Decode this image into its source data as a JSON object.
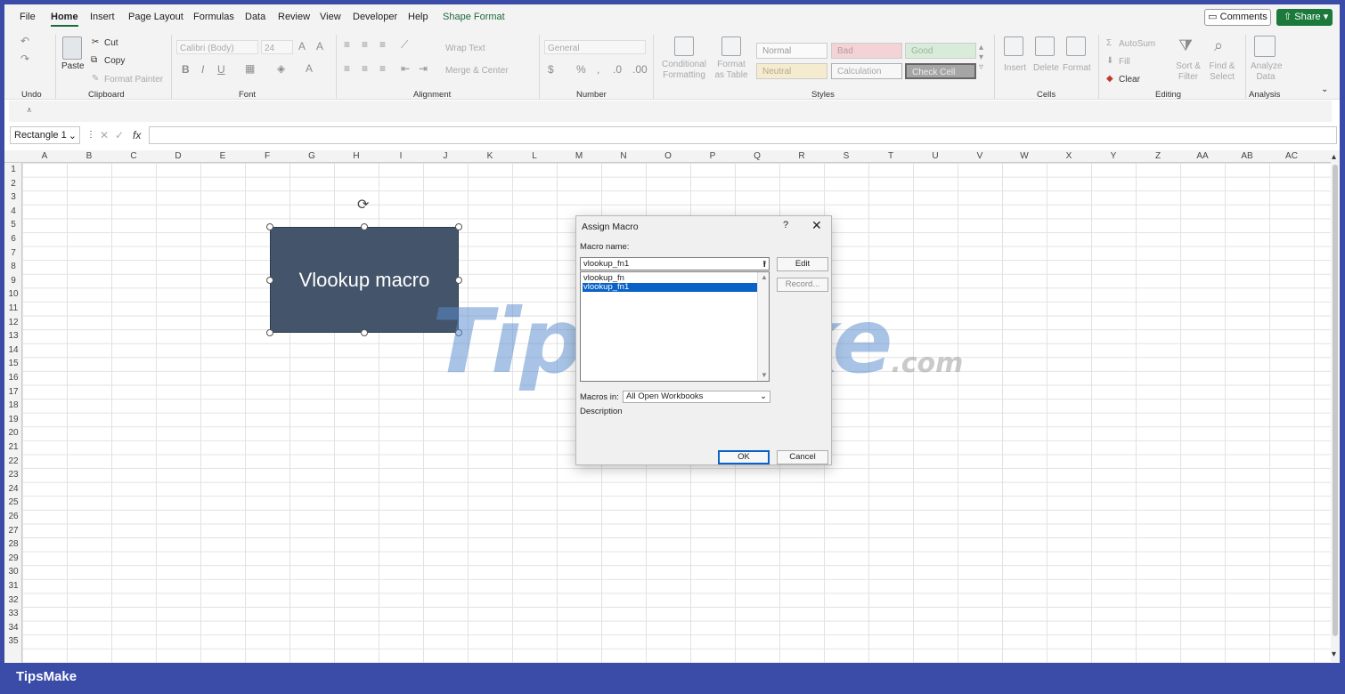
{
  "menu": {
    "items": [
      "File",
      "Home",
      "Insert",
      "Page Layout",
      "Formulas",
      "Data",
      "Review",
      "View",
      "Developer",
      "Help",
      "Shape Format"
    ],
    "active": "Home",
    "comments": "Comments",
    "share": "Share"
  },
  "ribbon": {
    "undo_group": "Undo",
    "clipboard": {
      "paste": "Paste",
      "cut": "Cut",
      "copy": "Copy",
      "format_painter": "Format Painter",
      "label": "Clipboard"
    },
    "font": {
      "name": "Calibri (Body)",
      "size": "24",
      "bold": "B",
      "italic": "I",
      "underline": "U",
      "label": "Font"
    },
    "alignment": {
      "wrap": "Wrap Text",
      "merge": "Merge & Center",
      "label": "Alignment"
    },
    "number": {
      "format": "General",
      "label": "Number"
    },
    "styles": {
      "cond_format": "Conditional Formatting",
      "format_table": "Format as Table",
      "cells": [
        "Normal",
        "Bad",
        "Good",
        "Neutral",
        "Calculation",
        "Check Cell"
      ],
      "label": "Styles"
    },
    "cells_group": {
      "insert": "Insert",
      "delete": "Delete",
      "format": "Format",
      "label": "Cells"
    },
    "editing": {
      "autosum": "AutoSum",
      "fill": "Fill",
      "clear": "Clear",
      "sort": "Sort & Filter",
      "find": "Find & Select",
      "label": "Editing"
    },
    "analysis": {
      "analyze": "Analyze Data",
      "label": "Analysis"
    }
  },
  "namebox": "Rectangle 1",
  "fx": "fx",
  "columns": [
    "A",
    "B",
    "C",
    "D",
    "E",
    "F",
    "G",
    "H",
    "I",
    "J",
    "K",
    "L",
    "M",
    "N",
    "O",
    "P",
    "Q",
    "R",
    "S",
    "T",
    "U",
    "V",
    "W",
    "X",
    "Y",
    "Z",
    "AA",
    "AB",
    "AC"
  ],
  "rows": [
    "1",
    "2",
    "3",
    "4",
    "5",
    "6",
    "7",
    "8",
    "9",
    "10",
    "11",
    "12",
    "13",
    "14",
    "15",
    "16",
    "17",
    "18",
    "19",
    "20",
    "21",
    "22",
    "23",
    "24",
    "25",
    "26",
    "27",
    "28",
    "29",
    "30",
    "31",
    "32",
    "33",
    "34",
    "35"
  ],
  "shape": {
    "text": "Vlookup macro"
  },
  "dialog": {
    "title": "Assign Macro",
    "help": "?",
    "close": "✕",
    "macro_name_label": "Macro name:",
    "macro_name_value": "vlookup_fn1",
    "macros": [
      "vlookup_fn",
      "vlookup_fn1"
    ],
    "selected": "vlookup_fn1",
    "edit": "Edit",
    "record": "Record...",
    "macros_in_label": "Macros in:",
    "macros_in_value": "All Open Workbooks",
    "description_label": "Description",
    "ok": "OK",
    "cancel": "Cancel"
  },
  "watermark": {
    "main": "TipsMake",
    "suffix": ".com"
  },
  "brand": "TipsMake"
}
